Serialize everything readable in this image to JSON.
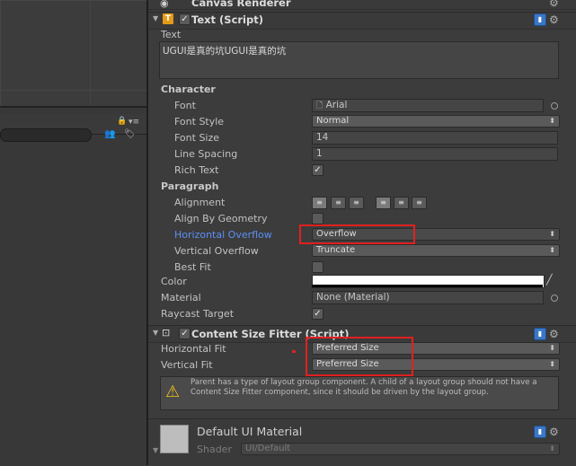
{
  "left": {
    "lock_icon": "lock-icon",
    "menu_icon": "menu-icon",
    "tools": [
      "persons-icon",
      "tag-icon"
    ]
  },
  "canvas_renderer": {
    "title": "Canvas Renderer"
  },
  "text_script": {
    "title": "Text (Script)",
    "text_label": "Text",
    "text_value": "UGUI是真的坑UGUI是真的坑",
    "character_header": "Character",
    "font_label": "Font",
    "font_value": "Arial",
    "font_style_label": "Font Style",
    "font_style_value": "Normal",
    "font_size_label": "Font Size",
    "font_size_value": "14",
    "line_spacing_label": "Line Spacing",
    "line_spacing_value": "1",
    "rich_text_label": "Rich Text",
    "rich_text_checked": true,
    "paragraph_header": "Paragraph",
    "alignment_label": "Alignment",
    "align_by_geometry_label": "Align By Geometry",
    "align_by_geometry_checked": false,
    "h_overflow_label": "Horizontal Overflow",
    "h_overflow_value": "Overflow",
    "v_overflow_label": "Vertical Overflow",
    "v_overflow_value": "Truncate",
    "best_fit_label": "Best Fit",
    "best_fit_checked": false,
    "color_label": "Color",
    "color_value": "#ffffff",
    "material_label": "Material",
    "material_value": "None (Material)",
    "raycast_label": "Raycast Target",
    "raycast_checked": true
  },
  "csf": {
    "title": "Content Size Fitter (Script)",
    "h_fit_label": "Horizontal Fit",
    "h_fit_value": "Preferred Size",
    "v_fit_label": "Vertical Fit",
    "v_fit_value": "Preferred Size",
    "warning": "Parent has a type of layout group component. A child of a layout group should not have a Content Size Fitter component, since it should be driven by the layout group."
  },
  "material": {
    "title": "Default UI Material",
    "shader_label": "Shader",
    "shader_value": "UI/Default"
  },
  "colors": {
    "accent_blue": "#3b77c7",
    "highlight_label": "#5b8ff5",
    "red_box": "#e02020",
    "warning": "#f0c020"
  }
}
